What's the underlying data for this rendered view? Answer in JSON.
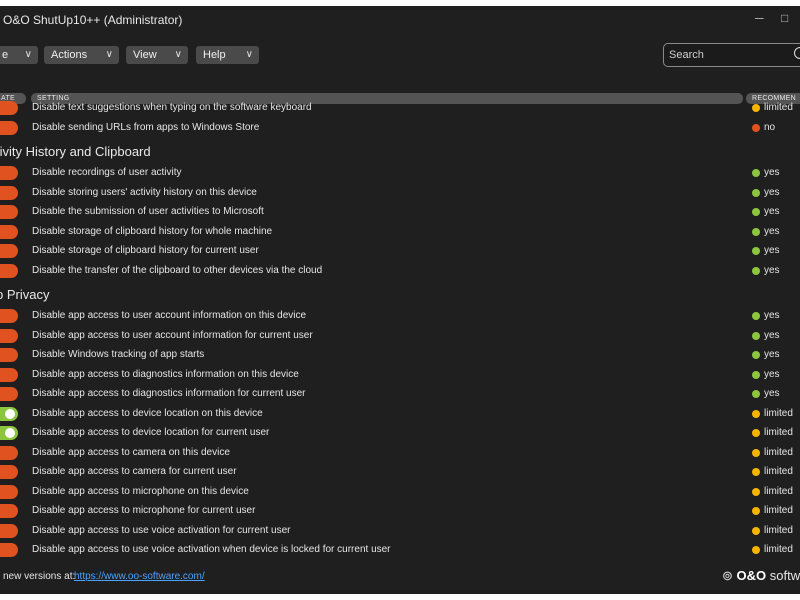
{
  "window": {
    "title": "O&O ShutUp10++ (Administrator)"
  },
  "toolbar": {
    "menus": [
      {
        "label": "e"
      },
      {
        "label": "Actions"
      },
      {
        "label": "View"
      },
      {
        "label": "Help"
      }
    ],
    "caret_icon": "chevron-down-icon",
    "search_placeholder": "Search"
  },
  "columns": {
    "state": "ATE",
    "setting": "SETTING",
    "recommended": "RECOMMEN"
  },
  "status_colors": {
    "yes": "#8cc63f",
    "limited": "#f5b400",
    "no": "#e0521f"
  },
  "toggle_colors": {
    "off": "#e0521f",
    "on": "#8cc63f"
  },
  "rows_top": [
    {
      "label": "Disable text suggestions when typing on the software keyboard",
      "recommended": "limited",
      "on": false
    },
    {
      "label": "Disable sending URLs from apps to Windows Store",
      "recommended": "no",
      "on": false
    }
  ],
  "groups": [
    {
      "title": "tivity History and Clipboard",
      "rows": [
        {
          "label": "Disable recordings of user activity",
          "recommended": "yes",
          "on": false
        },
        {
          "label": "Disable storing users' activity history on this device",
          "recommended": "yes",
          "on": false
        },
        {
          "label": "Disable the submission of user activities to Microsoft",
          "recommended": "yes",
          "on": false
        },
        {
          "label": "Disable storage of clipboard history for whole machine",
          "recommended": "yes",
          "on": false
        },
        {
          "label": "Disable storage of clipboard history for current user",
          "recommended": "yes",
          "on": false
        },
        {
          "label": "Disable the transfer of the clipboard to other devices via the cloud",
          "recommended": "yes",
          "on": false
        }
      ]
    },
    {
      "title": "p Privacy",
      "rows": [
        {
          "label": "Disable app access to user account information on this device",
          "recommended": "yes",
          "on": false
        },
        {
          "label": "Disable app access to user account information for current user",
          "recommended": "yes",
          "on": false
        },
        {
          "label": "Disable Windows tracking of app starts",
          "recommended": "yes",
          "on": false
        },
        {
          "label": "Disable app access to diagnostics information on this device",
          "recommended": "yes",
          "on": false
        },
        {
          "label": "Disable app access to diagnostics information for current user",
          "recommended": "yes",
          "on": false
        },
        {
          "label": "Disable app access to device location on this device",
          "recommended": "limited",
          "on": true
        },
        {
          "label": "Disable app access to device location for current user",
          "recommended": "limited",
          "on": true
        },
        {
          "label": "Disable app access to camera on this device",
          "recommended": "limited",
          "on": false
        },
        {
          "label": "Disable app access to camera for current user",
          "recommended": "limited",
          "on": false
        },
        {
          "label": "Disable app access to microphone on this device",
          "recommended": "limited",
          "on": false
        },
        {
          "label": "Disable app access to microphone for current user",
          "recommended": "limited",
          "on": false
        },
        {
          "label": "Disable app access to use voice activation for current user",
          "recommended": "limited",
          "on": false
        },
        {
          "label": "Disable app access to use voice activation when device is locked for current user",
          "recommended": "limited",
          "on": false
        }
      ]
    }
  ],
  "footer": {
    "text": "new versions at:",
    "link": "https://www.oo-software.com/",
    "logo_text": "O&O",
    "logo_suffix": "softw"
  }
}
